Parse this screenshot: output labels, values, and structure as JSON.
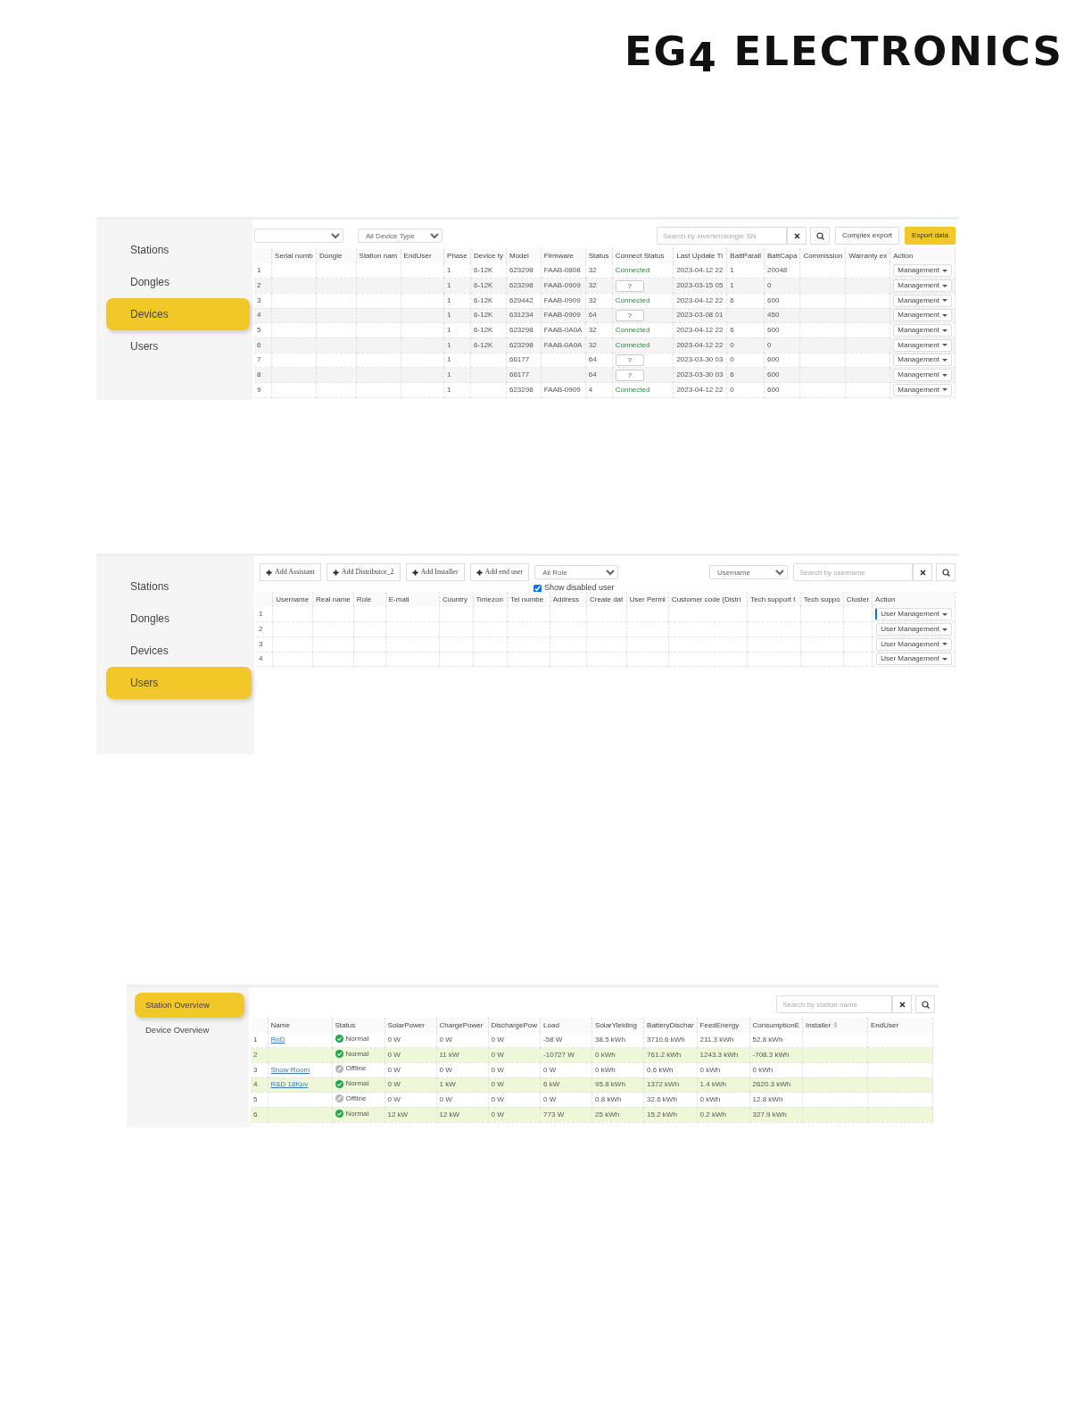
{
  "logo": {
    "text": "EG$_{4}$ ELECTRONICS"
  },
  "devices_panel": {
    "sidebar": [
      {
        "label": "Stations",
        "selected": false
      },
      {
        "label": "Dongles",
        "selected": false
      },
      {
        "label": "Devices",
        "selected": true
      },
      {
        "label": "Users",
        "selected": false
      }
    ],
    "device_type_select": {
      "value": "All Device Type"
    },
    "search": {
      "placeholder": "Search by inverter/dongle SN"
    },
    "buttons": [
      {
        "label": "Complex export",
        "kind": "default"
      },
      {
        "label": "Export data",
        "kind": "primary"
      }
    ],
    "table": {
      "columns": [
        "Serial numb",
        "Dongle",
        "Station nam",
        "EndUser",
        "Phase",
        "Device ty",
        "Model",
        "Firmware",
        "Status",
        "Connect Status",
        "Last Update Ti",
        "BattParall",
        "BattCapa",
        "Commission",
        "Warranty ex",
        "Action"
      ],
      "rows": [
        {
          "number": "1",
          "phase": "1",
          "device_type": "6-12K",
          "model": "623298",
          "firmware": "FAAB-0808",
          "status": "32",
          "connect_status": {
            "kind": "text",
            "text": "Connected"
          },
          "last_update": "2023-04-12 22",
          "batt_parallel": "1",
          "batt_capacity": "20048",
          "action": "Management"
        },
        {
          "number": "2",
          "phase": "1",
          "device_type": "6-12K",
          "model": "623298",
          "firmware": "FAAB-0909",
          "status": "32",
          "connect_status": {
            "kind": "box",
            "text": "?"
          },
          "last_update": "2023-03-15 05",
          "batt_parallel": "1",
          "batt_capacity": "0",
          "action": "Management"
        },
        {
          "number": "3",
          "phase": "1",
          "device_type": "6-12K",
          "model": "629442",
          "firmware": "FAAB-0909",
          "status": "32",
          "connect_status": {
            "kind": "text",
            "text": "Connected"
          },
          "last_update": "2023-04-12 22",
          "batt_parallel": "6",
          "batt_capacity": "600",
          "action": "Management"
        },
        {
          "number": "4",
          "phase": "1",
          "device_type": "6-12K",
          "model": "631234",
          "firmware": "FAAB-0909",
          "status": "64",
          "connect_status": {
            "kind": "box",
            "text": "?"
          },
          "last_update": "2023-03-08 01",
          "batt_capacity": "450",
          "action": "Management"
        },
        {
          "number": "5",
          "phase": "1",
          "device_type": "6-12K",
          "model": "623298",
          "firmware": "FAAB-0A0A",
          "status": "32",
          "connect_status": {
            "kind": "text",
            "text": "Connected"
          },
          "last_update": "2023-04-12 22",
          "batt_parallel": "6",
          "batt_capacity": "600",
          "action": "Management"
        },
        {
          "number": "6",
          "phase": "1",
          "device_type": "6-12K",
          "model": "623298",
          "firmware": "FAAB-0A0A",
          "status": "32",
          "connect_status": {
            "kind": "text",
            "text": "Connected"
          },
          "last_update": "2023-04-12 22",
          "batt_parallel": "0",
          "batt_capacity": "0",
          "action": "Management"
        },
        {
          "number": "7",
          "phase": "1",
          "model": "66177",
          "status": "64",
          "connect_status": {
            "kind": "box",
            "text": "?"
          },
          "last_update": "2023-03-30 03",
          "batt_parallel": "0",
          "batt_capacity": "600",
          "action": "Management"
        },
        {
          "number": "8",
          "phase": "1",
          "model": "66177",
          "status": "64",
          "connect_status": {
            "kind": "box",
            "text": "?"
          },
          "last_update": "2023-03-30 03",
          "batt_parallel": "6",
          "batt_capacity": "600",
          "action": "Management"
        },
        {
          "number": "9",
          "phase": "1",
          "model": "623298",
          "firmware": "FAAB-0909",
          "status": "4",
          "connect_status": {
            "kind": "text",
            "text": "Connected"
          },
          "last_update": "2023-04-12 22",
          "batt_parallel": "0",
          "batt_capacity": "600",
          "action": "Management"
        }
      ]
    }
  },
  "users_panel": {
    "sidebar": [
      {
        "label": "Stations",
        "selected": false
      },
      {
        "label": "Dongles",
        "selected": false
      },
      {
        "label": "Devices",
        "selected": false
      },
      {
        "label": "Users",
        "selected": true
      }
    ],
    "add_buttons": [
      "Add Assistant",
      "Add Distributor_2",
      "Add Installer",
      "Add end user"
    ],
    "role_select": {
      "value": "All Role"
    },
    "show_disabled": {
      "label": "Show disabled user",
      "checked": true
    },
    "search_type_select": {
      "value": "Username"
    },
    "search": {
      "placeholder": "Search by username"
    },
    "table": {
      "columns": [
        "Username",
        "Real name",
        "Role",
        "E-mail",
        "Country",
        "Timezon",
        "Tel numbe",
        "Address",
        "Create dat",
        "User Permi",
        "Customer code (Distri",
        "Tech support t",
        "Tech suppo",
        "Cluster",
        "Action"
      ],
      "rows": [
        {
          "number": "1",
          "action": "User Management",
          "focused": true
        },
        {
          "number": "2",
          "action": "User Management",
          "focused": false
        },
        {
          "number": "3",
          "action": "User Management",
          "focused": false
        },
        {
          "number": "4",
          "action": "User Management",
          "focused": false
        }
      ]
    }
  },
  "stations_panel": {
    "sidebar": [
      {
        "label": "Station Overview",
        "selected": true
      },
      {
        "label": "Device Overview",
        "selected": false
      }
    ],
    "search": {
      "placeholder": "Search by station name"
    },
    "table": {
      "columns": [
        "Name",
        "Status",
        "SolarPower",
        "ChargePower",
        "DischargePow",
        "Load",
        "SolarYielding",
        "BatteryDischar",
        "FeedEnergy",
        "ConsumptionE",
        "Installer",
        "EndUser"
      ],
      "rows": [
        {
          "number": "1",
          "name": "RnD",
          "status": {
            "kind": "normal",
            "text": "Normal"
          },
          "values": [
            "0 W",
            "0 W",
            "0 W",
            "-58 W",
            "38.5 kWh",
            "3710.6 kWh",
            "211.3 kWh",
            "52.8 kWh"
          ],
          "highlighted": false
        },
        {
          "number": "2",
          "status": {
            "kind": "normal",
            "text": "Normal"
          },
          "values": [
            "0 W",
            "11 kW",
            "0 W",
            "-10727 W",
            "0 kWh",
            "761.2 kWh",
            "1243.3 kWh",
            "-708.3 kWh"
          ],
          "highlighted": true
        },
        {
          "number": "3",
          "name": "Show Room",
          "status": {
            "kind": "offline",
            "text": "Offline"
          },
          "values": [
            "0 W",
            "0 W",
            "0 W",
            "0 W",
            "0 kWh",
            "0.6 kWh",
            "0 kWh",
            "0 kWh"
          ],
          "highlighted": false
        },
        {
          "number": "4",
          "name": "R&D 18Kpv",
          "status": {
            "kind": "normal",
            "text": "Normal"
          },
          "values": [
            "0 W",
            "1 kW",
            "0 W",
            "6 kW",
            "95.8 kWh",
            "1372 kWh",
            "1.4 kWh",
            "2620.3 kWh"
          ],
          "highlighted": true
        },
        {
          "number": "5",
          "status": {
            "kind": "offline",
            "text": "Offline"
          },
          "values": [
            "0 W",
            "0 W",
            "0 W",
            "0 W",
            "0.8 kWh",
            "32.6 kWh",
            "0 kWh",
            "12.8 kWh"
          ],
          "highlighted": false
        },
        {
          "number": "6",
          "status": {
            "kind": "normal",
            "text": "Normal"
          },
          "values": [
            "12 kW",
            "12 kW",
            "0 W",
            "773 W",
            "25 kWh",
            "15.2 kWh",
            "0.2 kWh",
            "327.9 kWh"
          ],
          "highlighted": true
        }
      ]
    }
  }
}
